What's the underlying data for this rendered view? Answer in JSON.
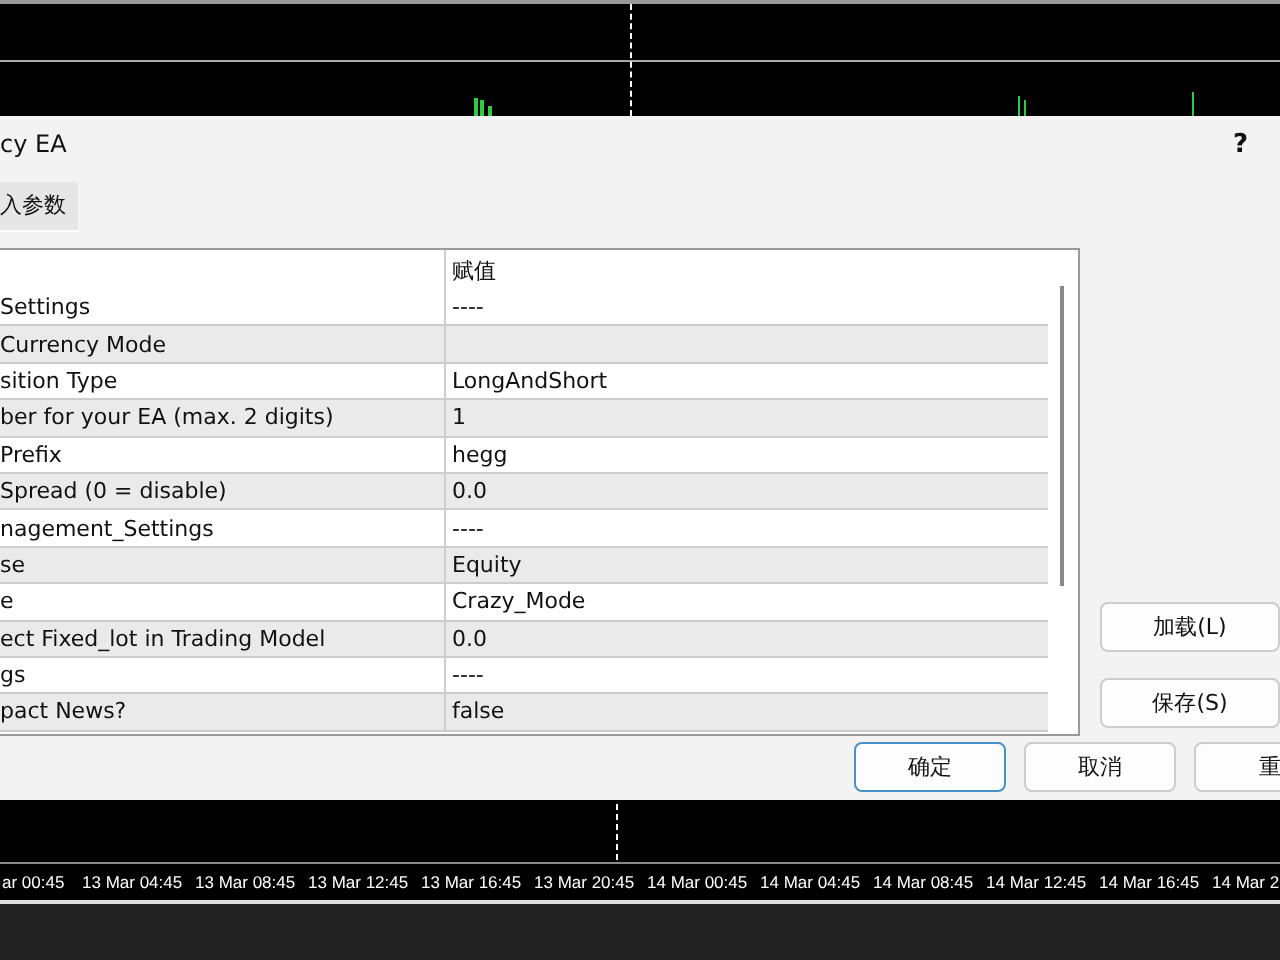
{
  "window": {
    "title": "cy EA",
    "help": "?"
  },
  "tabs": [
    {
      "label": "入参数",
      "selected": true
    }
  ],
  "table": {
    "columns": [
      "",
      "赋值"
    ],
    "rows": [
      {
        "name": "Settings",
        "value": "----"
      },
      {
        "name": "Currency Mode",
        "value": ""
      },
      {
        "name": "sition Type",
        "value": "LongAndShort"
      },
      {
        "name": "ber for your EA (max. 2 digits)",
        "value": "1"
      },
      {
        "name": "Prefix",
        "value": "hegg"
      },
      {
        "name": " Spread (0 = disable)",
        "value": "0.0"
      },
      {
        "name": "nagement_Settings",
        "value": "----"
      },
      {
        "name": "se",
        "value": "Equity"
      },
      {
        "name": "e",
        "value": "Crazy_Mode"
      },
      {
        "name": "ect Fixed_lot in Trading Model",
        "value": "0.0"
      },
      {
        "name": "gs",
        "value": "----"
      },
      {
        "name": "pact News?",
        "value": "false"
      }
    ]
  },
  "side_buttons": [
    "加载(L)",
    "保存(S)"
  ],
  "buttons": [
    {
      "label": "确定",
      "default": true
    },
    {
      "label": "取消",
      "default": false
    },
    {
      "label": "重",
      "default": false
    }
  ],
  "time_axis": [
    "ar 00:45",
    "13 Mar 04:45",
    "13 Mar 08:45",
    "13 Mar 12:45",
    "13 Mar 16:45",
    "13 Mar 20:45",
    "14 Mar 00:45",
    "14 Mar 04:45",
    "14 Mar 08:45",
    "14 Mar 12:45",
    "14 Mar 16:45",
    "14 Mar 2"
  ]
}
